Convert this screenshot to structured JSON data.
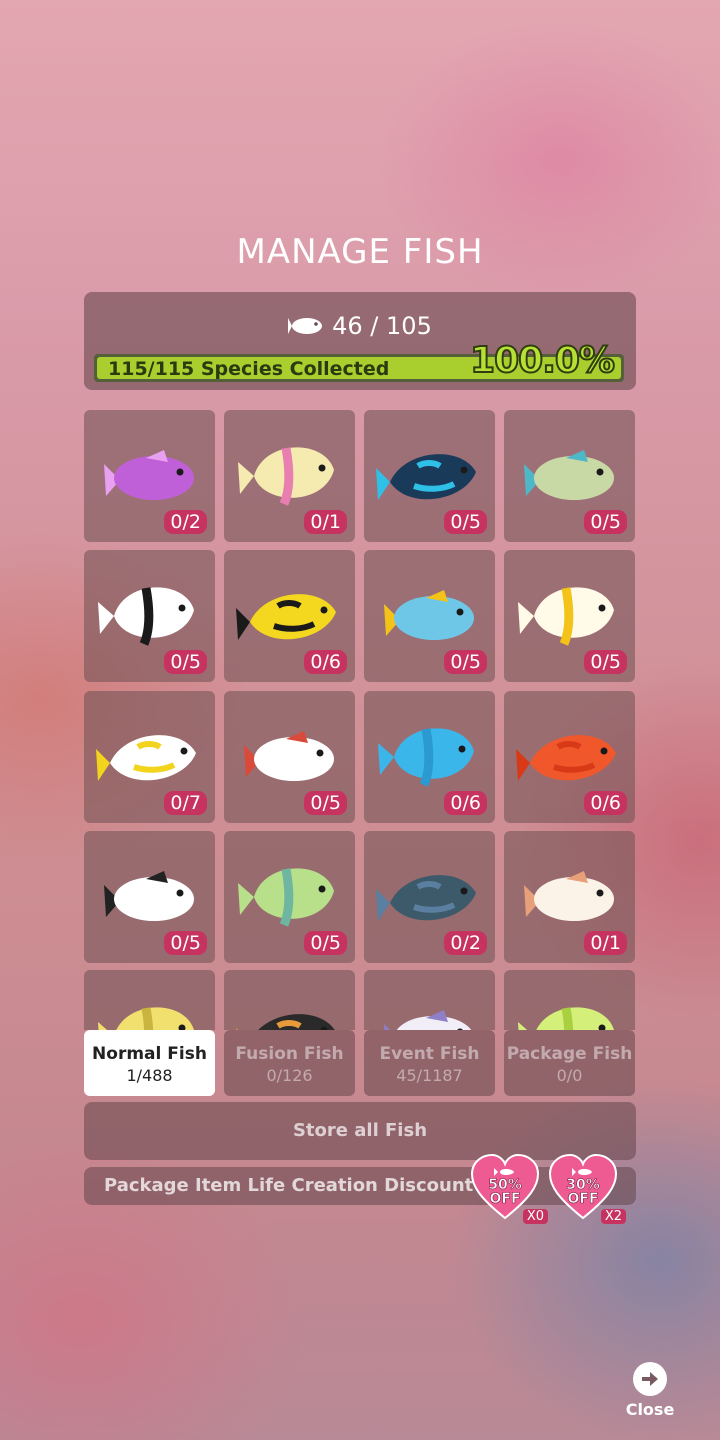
{
  "title": "MANAGE FISH",
  "summary": {
    "fish_icon": "fish-icon",
    "count_text": "46 / 105",
    "species_text": "115/115 Species Collected",
    "percent_text": "100.0%",
    "percent_value": 100
  },
  "grid": [
    {
      "name": "fish-purple-dottyback",
      "count": "0/2",
      "colors": [
        "#c060d8",
        "#e8a0f0"
      ]
    },
    {
      "name": "fish-yellow-pink-fish",
      "count": "0/1",
      "colors": [
        "#f5eab0",
        "#e87fb0"
      ]
    },
    {
      "name": "fish-blue-black-fish",
      "count": "0/5",
      "colors": [
        "#1a3a5a",
        "#2fc0e8"
      ]
    },
    {
      "name": "fish-mandarin-fish",
      "count": "0/5",
      "colors": [
        "#c9d9a6",
        "#4fb8c8"
      ]
    },
    {
      "name": "fish-black-white-butterfly",
      "count": "0/5",
      "colors": [
        "#ffffff",
        "#1a1a1a"
      ]
    },
    {
      "name": "fish-yellow-butterfly",
      "count": "0/6",
      "colors": [
        "#f4d71f",
        "#1a1a1a"
      ]
    },
    {
      "name": "fish-blue-striped-butterfly",
      "count": "0/5",
      "colors": [
        "#6fc7e8",
        "#f3c31a"
      ]
    },
    {
      "name": "fish-threadfin-butterfly",
      "count": "0/5",
      "colors": [
        "#fffbe8",
        "#f3c31a"
      ]
    },
    {
      "name": "fish-moorish-idol",
      "count": "0/7",
      "colors": [
        "#ffffff",
        "#f1d41b"
      ]
    },
    {
      "name": "fish-spotted-angelfish",
      "count": "0/5",
      "colors": [
        "#ffffff",
        "#d94a3a"
      ]
    },
    {
      "name": "fish-blue-parrotfish",
      "count": "0/6",
      "colors": [
        "#3bb6ea",
        "#2a9ad0"
      ]
    },
    {
      "name": "fish-red-parrotfish",
      "count": "0/6",
      "colors": [
        "#f0582c",
        "#d83a18"
      ]
    },
    {
      "name": "fish-spotted-grouper",
      "count": "0/5",
      "colors": [
        "#ffffff",
        "#222222"
      ]
    },
    {
      "name": "fish-green-wrasse",
      "count": "0/5",
      "colors": [
        "#b8e08a",
        "#6fb6a0"
      ]
    },
    {
      "name": "fish-dark-betta",
      "count": "0/2",
      "colors": [
        "#3d5a6a",
        "#5a7fa0"
      ]
    },
    {
      "name": "fish-white-puffer",
      "count": "0/1",
      "colors": [
        "#fbf3e8",
        "#e8a07a"
      ]
    },
    {
      "name": "fish-yellow-boxfish",
      "count": "",
      "colors": [
        "#f1df6e",
        "#c9b440"
      ]
    },
    {
      "name": "fish-orange-black-fish",
      "count": "",
      "colors": [
        "#2a2a2a",
        "#e69a3a"
      ]
    },
    {
      "name": "fish-white-purple-fish",
      "count": "",
      "colors": [
        "#f2eef8",
        "#8f7fc8"
      ]
    },
    {
      "name": "fish-green-fin-fish",
      "count": "",
      "colors": [
        "#d4f07a",
        "#a8d040"
      ]
    }
  ],
  "tabs": [
    {
      "label": "Normal Fish",
      "count": "1/488",
      "active": true
    },
    {
      "label": "Fusion Fish",
      "count": "0/126",
      "active": false
    },
    {
      "label": "Event Fish",
      "count": "45/1187",
      "active": false
    },
    {
      "label": "Package Fish",
      "count": "0/0",
      "active": false
    }
  ],
  "store_label": "Store all Fish",
  "discount": {
    "text": "Package Item Life Creation Discount 51%",
    "coupons": [
      {
        "line1": "50%",
        "line2": "OFF",
        "mult": "X0"
      },
      {
        "line1": "30%",
        "line2": "OFF",
        "mult": "X2"
      }
    ]
  },
  "close_label": "Close",
  "colors": {
    "accent": "#c73360",
    "progress": "#a8cf2e",
    "heart": "#ee5a92"
  }
}
